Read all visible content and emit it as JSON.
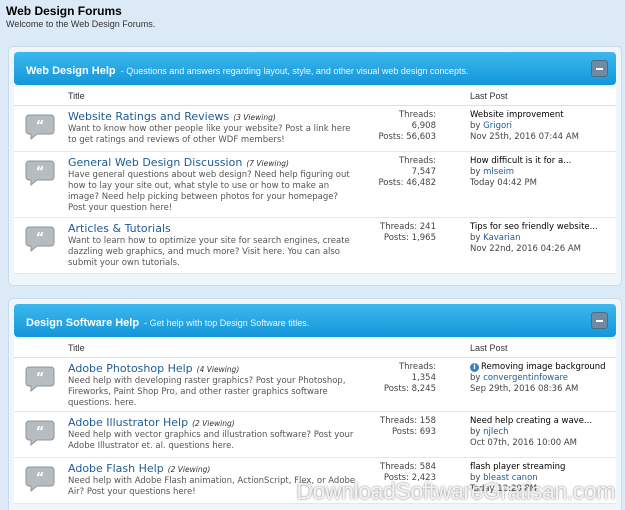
{
  "site": {
    "title": "Web Design Forums",
    "subtitle": "Welcome to the Web Design Forums."
  },
  "columns": {
    "title": "Title",
    "last_post": "Last Post"
  },
  "sections": [
    {
      "title": "Web Design Help",
      "description": "- Questions and answers regarding layout, style, and other visual web design concepts.",
      "forums": [
        {
          "name": "Website Ratings and Reviews",
          "viewing": "(3 Viewing)",
          "description": "Want to know how other people like your website? Post a link here to get ratings and reviews of other WDF members!",
          "threads_label": "Threads:",
          "threads": "6,908",
          "posts_label": "Posts:",
          "posts": "56,603",
          "last_title": "Website improvement",
          "last_by": "by",
          "last_user": "Grigori",
          "last_date": "Nov 25th, 2016 07:44 AM"
        },
        {
          "name": "General Web Design Discussion",
          "viewing": "(7 Viewing)",
          "description": "Have general questions about web design? Need help figuring out how to lay your site out, what style to use or how to make an image? Need help picking between photos for your homepage? Post your question here!",
          "threads_label": "Threads:",
          "threads": "7,547",
          "posts_label": "Posts:",
          "posts": "46,482",
          "last_title": "How difficult is it for a...",
          "last_by": "by",
          "last_user": "mlseim",
          "last_date": "Today 04:42 PM"
        },
        {
          "name": "Articles & Tutorials",
          "viewing": "",
          "description": "Want to learn how to optimize your site for search engines, create dazzling web graphics, and much more? Visit here. You can also submit your own tutorials.",
          "threads_label": "Threads:",
          "threads": "241",
          "posts_label": "Posts:",
          "posts": "1,965",
          "last_title": "Tips for seo friendly website...",
          "last_by": "by",
          "last_user": "Kavarian",
          "last_date": "Nov 22nd, 2016 04:26 AM"
        }
      ]
    },
    {
      "title": "Design Software Help",
      "description": "- Get help with top Design Software titles.",
      "forums": [
        {
          "name": "Adobe Photoshop Help",
          "viewing": "(4 Viewing)",
          "description": "Need help with developing raster graphics? Post your Photoshop, Fireworks, Paint Shop Pro, and other raster graphics software questions. here.",
          "threads_label": "Threads:",
          "threads": "1,354",
          "posts_label": "Posts:",
          "posts": "8,245",
          "last_title": "Removing image background",
          "last_by": "by",
          "last_user": "convergentinfoware",
          "last_date": "Sep 29th, 2016 08:36 AM"
        },
        {
          "name": "Adobe Illustrator Help",
          "viewing": "(2 Viewing)",
          "description": "Need help with vector graphics and illustration software? Post your Adobe Illustrator et. al. questions here.",
          "threads_label": "Threads:",
          "threads": "158",
          "posts_label": "Posts:",
          "posts": "693",
          "last_title": "Need help creating a wave...",
          "last_by": "by",
          "last_user": "njlech",
          "last_date": "Oct 07th, 2016 10:00 AM"
        },
        {
          "name": "Adobe Flash Help",
          "viewing": "(2 Viewing)",
          "description": "Need help with Adobe Flash animation, ActionScript, Flex, or Adobe Air? Post your questions here!",
          "threads_label": "Threads:",
          "threads": "584",
          "posts_label": "Posts:",
          "posts": "2,423",
          "last_title": "flash player streaming",
          "last_by": "by",
          "last_user": "bleast canon",
          "last_date": "Today 12:20 PM"
        }
      ]
    }
  ],
  "watermark": "DownloadSoftwareGratisan.com"
}
